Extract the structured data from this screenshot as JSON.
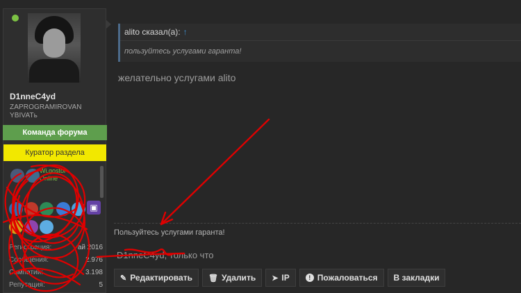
{
  "user": {
    "username": "D1nneC4yd",
    "title": "ZAPROGRAMIROVAN YBIVATь",
    "badges": [
      "Команда форума",
      "Куратор раздела"
    ],
    "status": "Online",
    "mini_name": "Wi.gostol"
  },
  "stats": [
    {
      "label": "Регистрация:",
      "value": "ай 2016"
    },
    {
      "label": "Сообщения:",
      "value": "2.976"
    },
    {
      "label": "Симпатии:",
      "value": "3.198"
    },
    {
      "label": "Репутация:",
      "value": "5"
    }
  ],
  "quote": {
    "author": "alito сказал(а):",
    "arrow": "↑",
    "text": "пользуйтесь услугами гаранта!"
  },
  "message": "желательно услугами alito",
  "signature": "Пользуйтесь услугами гаранта!",
  "post_meta": "D1nneC4yd, только что",
  "actions": [
    {
      "icon": "✎",
      "label": "Редактировать"
    },
    {
      "icon": "🗑",
      "label": "Удалить"
    },
    {
      "icon": "➤",
      "label": "IP"
    },
    {
      "icon": "!",
      "label": "Пожаловаться"
    },
    {
      "icon": "",
      "label": "В закладки"
    }
  ],
  "colors": {
    "background": "#272727",
    "badge_green": "#5e9e4d",
    "badge_yellow": "#f2e800",
    "online": "#7cc144",
    "scribble": "#e00000",
    "twitch": "#6441a5"
  }
}
